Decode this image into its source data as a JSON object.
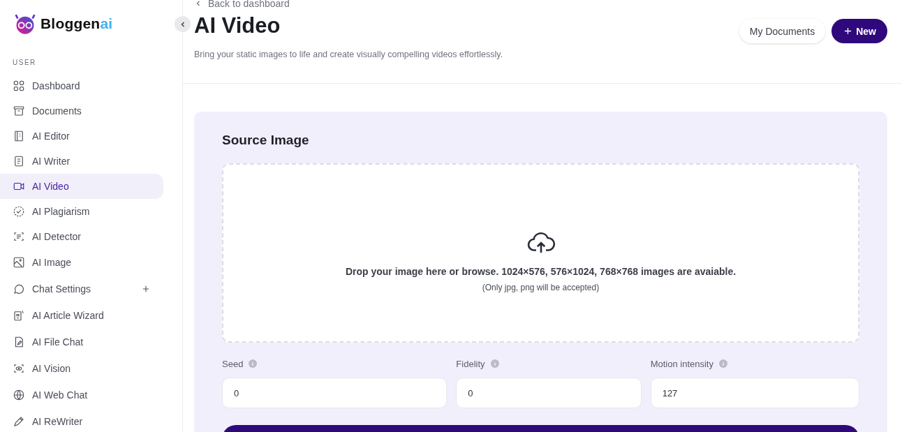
{
  "brand": {
    "name": "Bloggen",
    "accent": "ai"
  },
  "sidebar": {
    "section": "USER",
    "items": [
      {
        "label": "Dashboard",
        "selected": false
      },
      {
        "label": "Documents",
        "selected": false
      },
      {
        "label": "AI Editor",
        "selected": false
      },
      {
        "label": "AI Writer",
        "selected": false
      },
      {
        "label": "AI Video",
        "selected": true
      },
      {
        "label": "AI Plagiarism",
        "selected": false
      },
      {
        "label": "AI Detector",
        "selected": false
      },
      {
        "label": "AI Image",
        "selected": false
      },
      {
        "label": "Chat Settings",
        "selected": false,
        "expanded": false
      },
      {
        "label": "AI Article Wizard",
        "selected": false
      },
      {
        "label": "AI File Chat",
        "selected": false
      },
      {
        "label": "AI Vision",
        "selected": false
      },
      {
        "label": "AI Web Chat",
        "selected": false
      },
      {
        "label": "AI ReWriter",
        "selected": false
      }
    ]
  },
  "header": {
    "back_link": "Back to dashboard",
    "title": "AI Video",
    "subtitle": "Bring your static images to life and create visually compelling videos effortlessly.",
    "buttons": [
      {
        "label": "My Documents",
        "kind": "secondary"
      },
      {
        "label": "New",
        "kind": "primary"
      }
    ]
  },
  "source": {
    "title": "Source Image",
    "drop_text": "Drop your image here or browse. 1024×576, 576×1024, 768×768 images are avaiable.",
    "drop_hint": "(Only jpg, png will be accepted)"
  },
  "fields": [
    {
      "label": "Seed",
      "value": "0"
    },
    {
      "label": "Fidelity",
      "value": "0"
    },
    {
      "label": "Motion intensity",
      "value": "127"
    }
  ]
}
